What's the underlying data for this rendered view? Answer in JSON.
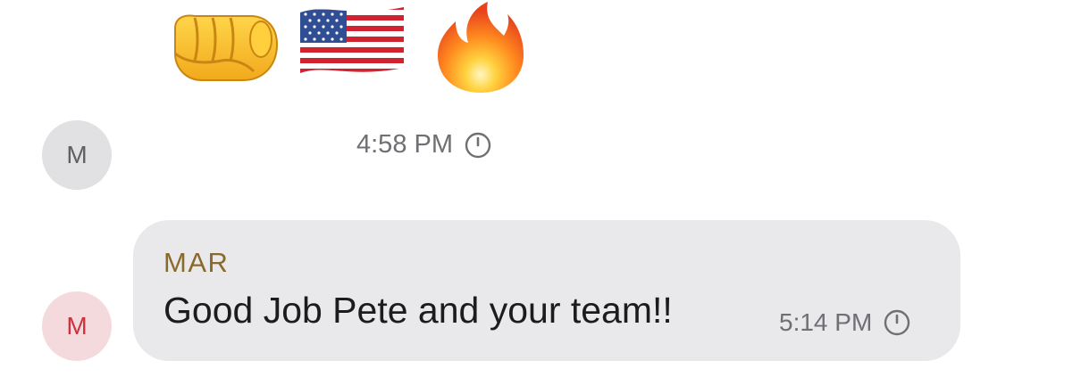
{
  "reactions": [
    {
      "icon": "oncoming-fist-icon"
    },
    {
      "icon": "us-flag-icon"
    },
    {
      "icon": "fire-icon"
    }
  ],
  "messages": [
    {
      "avatar_initial": "M",
      "time": "4:58 PM",
      "status_icon": "clock-icon"
    },
    {
      "avatar_initial": "M",
      "sender": "MAR",
      "text": "Good Job Pete and your team!!",
      "time": "5:14 PM",
      "status_icon": "clock-icon"
    }
  ],
  "colors": {
    "bubble_bg": "#e9e9eb",
    "sender_name": "#8a6a2a",
    "avatar1_bg": "#e1e1e3",
    "avatar2_bg": "#f5dadd",
    "avatar2_text": "#cc3340",
    "meta_text": "#6f6f74"
  }
}
